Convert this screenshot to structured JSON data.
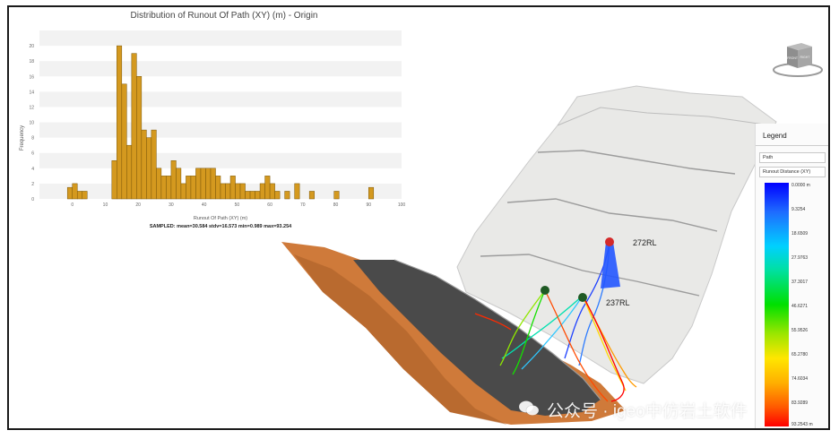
{
  "chart_data": {
    "type": "bar",
    "title": "Distribution of Runout Of Path (XY) (m) - Origin",
    "xlabel": "Runout Of Path (XY) (m)",
    "ylabel": "Frequency",
    "xlim": [
      -10,
      100
    ],
    "ylim": [
      0,
      22
    ],
    "bin_width": 1.5,
    "x_ticks": [
      0,
      10,
      20,
      30,
      40,
      50,
      60,
      70,
      80,
      90,
      100
    ],
    "y_ticks": [
      0,
      2,
      4,
      6,
      8,
      10,
      12,
      14,
      16,
      18,
      20
    ],
    "bar_color": "#d4991f",
    "series": [
      {
        "values": [
          [
            -0.75,
            1.5
          ],
          [
            0.75,
            2
          ],
          [
            2.25,
            1
          ],
          [
            3.75,
            1
          ],
          [
            12.75,
            5
          ],
          [
            14.25,
            20
          ],
          [
            15.75,
            15
          ],
          [
            17.25,
            7
          ],
          [
            18.75,
            19
          ],
          [
            20.25,
            16
          ],
          [
            21.75,
            9
          ],
          [
            23.25,
            8
          ],
          [
            24.75,
            9
          ],
          [
            26.25,
            4
          ],
          [
            27.75,
            3
          ],
          [
            29.25,
            3
          ],
          [
            30.75,
            5
          ],
          [
            32.25,
            4
          ],
          [
            33.75,
            2
          ],
          [
            35.25,
            3
          ],
          [
            36.75,
            3
          ],
          [
            38.25,
            4
          ],
          [
            39.75,
            4
          ],
          [
            41.25,
            4
          ],
          [
            42.75,
            4
          ],
          [
            44.25,
            3
          ],
          [
            45.75,
            2
          ],
          [
            47.25,
            2
          ],
          [
            48.75,
            3
          ],
          [
            50.25,
            2
          ],
          [
            51.75,
            2
          ],
          [
            53.25,
            1
          ],
          [
            54.75,
            1
          ],
          [
            56.25,
            1
          ],
          [
            57.75,
            2
          ],
          [
            59.25,
            3
          ],
          [
            60.75,
            2
          ],
          [
            62.25,
            1
          ],
          [
            65.25,
            1
          ],
          [
            68.25,
            2
          ],
          [
            72.75,
            1
          ],
          [
            80.25,
            1
          ],
          [
            90.75,
            1.5
          ]
        ]
      }
    ],
    "stats_line": "SAMPLED: mean=30.584 stdv=16.573 min=0.989 max=93.254"
  },
  "scene": {
    "label_272": "272RL",
    "label_237": "237RL",
    "watermark": "公众号 · igeo中仿岩土软件",
    "viewcube_faces": [
      "FRONT",
      "RIGHT"
    ]
  },
  "legend": {
    "title": "Legend",
    "field_path": "Path",
    "field_attribute": "Runout Distance (XY)",
    "ticks": [
      "0.0000 m",
      "9.3254",
      "18.6509",
      "27.9763",
      "37.3017",
      "46.6271",
      "55.9526",
      "65.2780",
      "74.6034",
      "83.9289",
      "93.2543 m"
    ],
    "gradient": [
      "#0000ff",
      "#00d0ff",
      "#00e000",
      "#ffe600",
      "#ff0000"
    ]
  }
}
